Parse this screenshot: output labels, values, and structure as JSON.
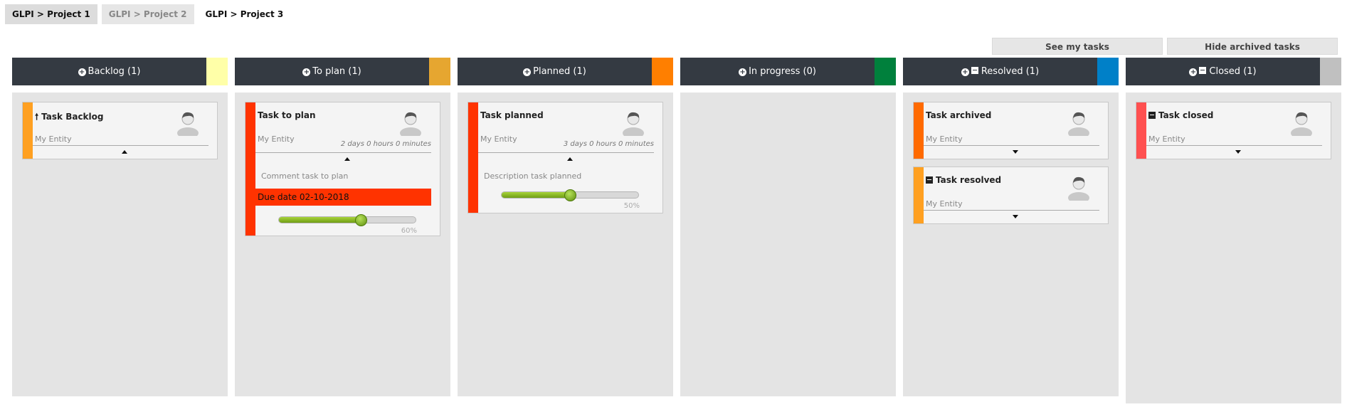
{
  "tabs": [
    {
      "label": "GLPI > Project 1"
    },
    {
      "label": "GLPI > Project 2"
    },
    {
      "label": "GLPI > Project 3"
    }
  ],
  "buttons": {
    "see_my_tasks": "See my tasks",
    "hide_archived": "Hide archived tasks"
  },
  "columns": [
    {
      "label": "Backlog (1)",
      "color": "#ffffa8"
    },
    {
      "label": "To plan (1)",
      "color": "#e6a630"
    },
    {
      "label": "Planned (1)",
      "color": "#ff7f00"
    },
    {
      "label": "In progress (0)",
      "color": "#00803c"
    },
    {
      "label": "Resolved (1)",
      "color": "#0080c8"
    },
    {
      "label": "Closed (1)",
      "color": "#c0c0c0"
    }
  ],
  "cards": {
    "backlog": {
      "title": "Task Backlog",
      "entity": "My Entity",
      "strip_color": "#ffa021"
    },
    "to_plan": {
      "title": "Task to plan",
      "entity": "My Entity",
      "duration": "2 days 0 hours 0 minutes",
      "description": "Comment task to plan",
      "due": "Due date 02-10-2018",
      "progress": 60,
      "progress_label": "60%",
      "strip_color": "#ff3300"
    },
    "planned": {
      "title": "Task planned",
      "entity": "My Entity",
      "duration": "3 days 0 hours 0 minutes",
      "description": "Description task planned",
      "progress": 50,
      "progress_label": "50%",
      "strip_color": "#ff3300"
    },
    "archived": {
      "title": "Task archived",
      "entity": "My Entity",
      "strip_color": "#ff6a00"
    },
    "resolved": {
      "title": "Task resolved",
      "entity": "My Entity",
      "strip_color": "#ffa021"
    },
    "closed": {
      "title": "Task closed",
      "entity": "My Entity",
      "strip_color": "#ff5050"
    }
  }
}
